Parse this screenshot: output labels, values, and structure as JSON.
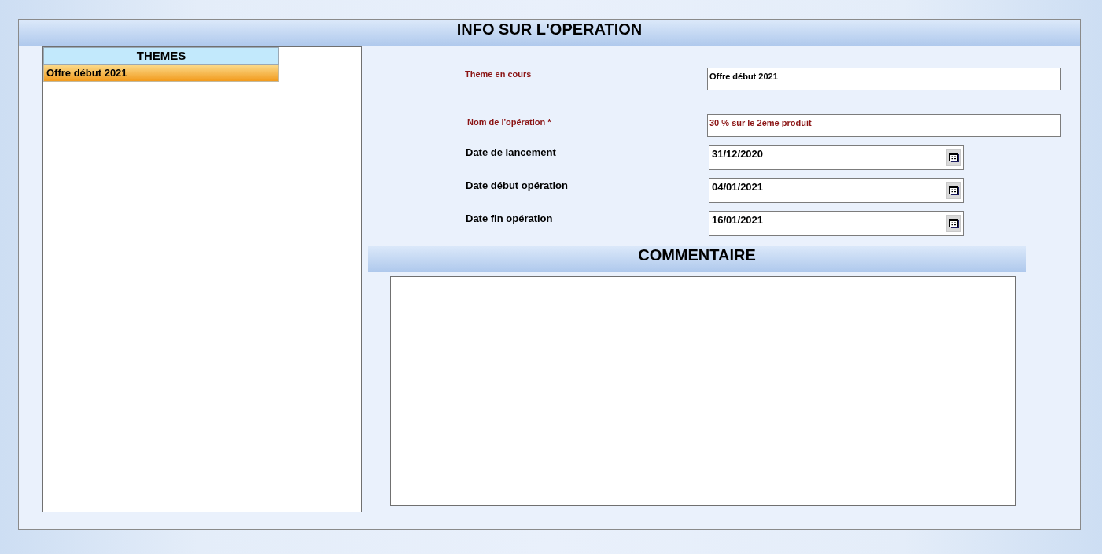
{
  "window": {
    "title": "INFO SUR L'OPERATION"
  },
  "themes": {
    "header": "THEMES",
    "items": [
      {
        "label": "Offre début 2021",
        "selected": true
      }
    ]
  },
  "form": {
    "fields": [
      {
        "kind": "info",
        "label": "Theme en cours",
        "value": "Offre début 2021"
      },
      {
        "kind": "input",
        "label": "Nom de l'opération *",
        "value": "30 % sur le 2ème produit"
      },
      {
        "kind": "date",
        "label": "Date de lancement",
        "value": "31/12/2020"
      },
      {
        "kind": "date",
        "label": "Date début opération",
        "value": "04/01/2021"
      },
      {
        "kind": "date",
        "label": "Date fin opération",
        "value": "16/01/2021"
      }
    ]
  },
  "comment": {
    "title": "COMMENTAIRE"
  }
}
